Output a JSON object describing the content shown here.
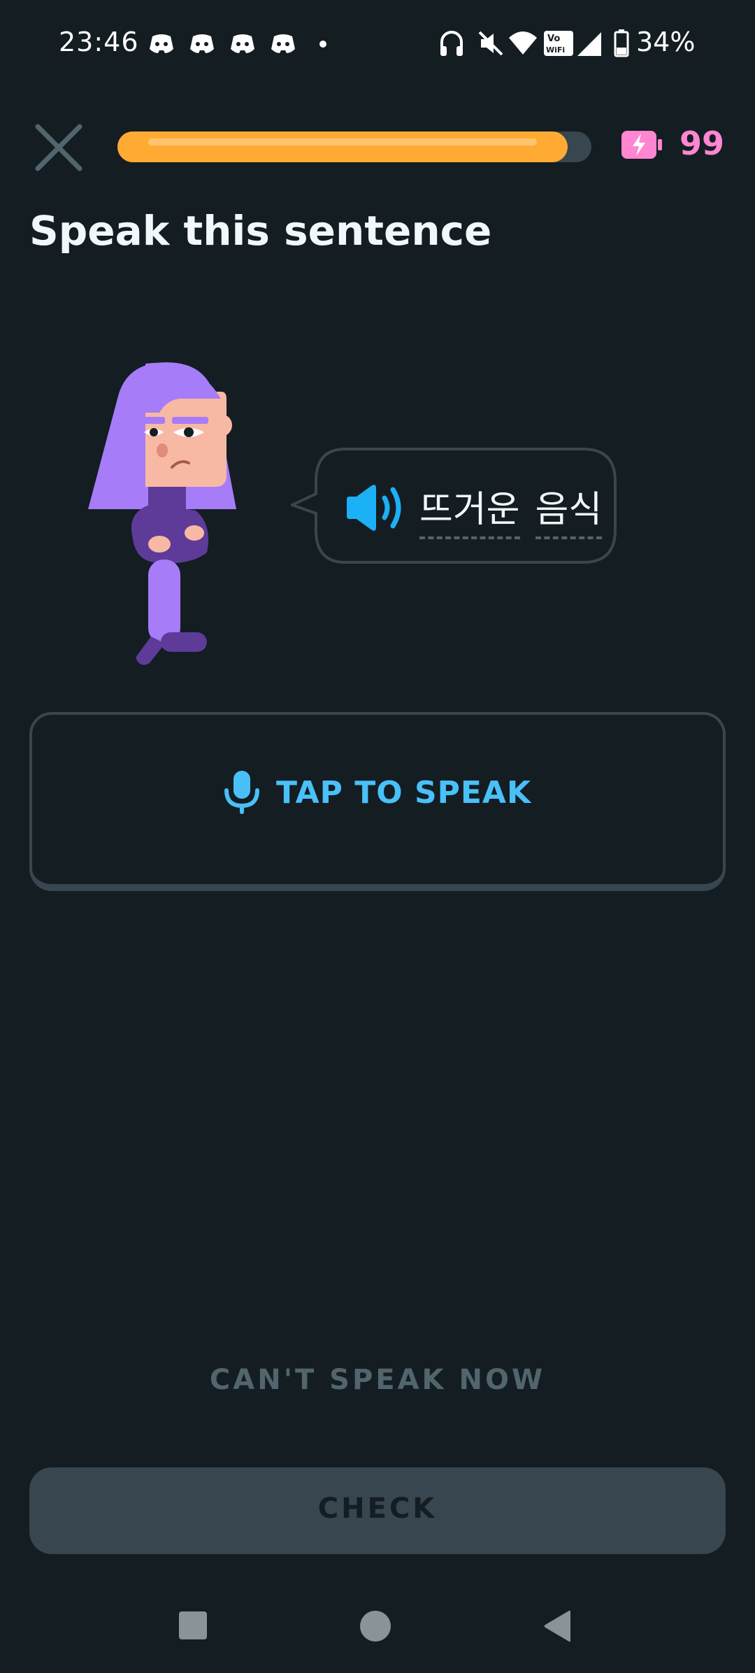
{
  "status_bar": {
    "time": "23:46",
    "notification_icons": [
      "discord-icon",
      "discord-icon",
      "discord-icon",
      "discord-icon"
    ],
    "right_icons": [
      "headphones-icon",
      "mute-icon",
      "wifi-icon",
      "vowifi-icon",
      "signal-icon",
      "battery-icon"
    ],
    "battery_percent": "34%"
  },
  "header": {
    "progress_fraction": 0.95,
    "energy_count": "99"
  },
  "prompt": {
    "title": "Speak this sentence"
  },
  "bubble": {
    "words": [
      "뜨거운",
      "음식"
    ]
  },
  "tap_to_speak": {
    "label": "TAP TO SPEAK"
  },
  "cant_speak": {
    "label": "CAN'T SPEAK NOW"
  },
  "check": {
    "label": "CHECK"
  },
  "colors": {
    "background": "#141d22",
    "progress": "#ffab33",
    "energy": "#ff86d0",
    "accent_blue": "#49c0f8",
    "border": "#37464f",
    "muted": "#52656d"
  }
}
